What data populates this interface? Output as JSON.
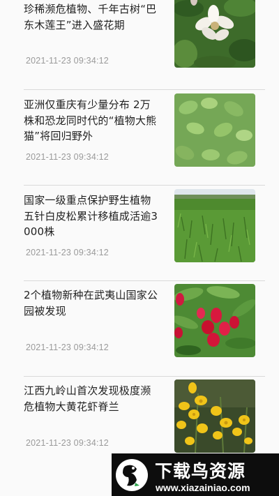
{
  "news": [
    {
      "title": "珍稀濒危植物、千年古树“巴东木莲王”进入盛花期",
      "time": "2021-11-23 09:34:12",
      "image": "white-magnolia-flower-photo"
    },
    {
      "title": "亚洲仅重庆有少量分布 2万株和恐龙同时代的“植物大熊猫”将回归野外",
      "time": "2021-11-23 09:34:12",
      "image": "green-leaves-plant-photo"
    },
    {
      "title": "国家一级重点保护野生植物五针白皮松累计移植成活逾3000株",
      "time": "2021-11-23 09:34:12",
      "image": "pine-seedling-field-photo"
    },
    {
      "title": "2个植物新种在武夷山国家公园被发现",
      "time": "2021-11-23 09:34:12",
      "image": "red-flower-plant-photo"
    },
    {
      "title": "江西九岭山首次发现极度濒危植物大黄花虾脊兰",
      "time": "2021-11-23 09:34:12",
      "image": "yellow-orchid-photo"
    }
  ],
  "watermark": {
    "title": "下载鸟资源",
    "url": "www.xiazainiao.com",
    "logo_icon": "bird-logo-icon"
  }
}
